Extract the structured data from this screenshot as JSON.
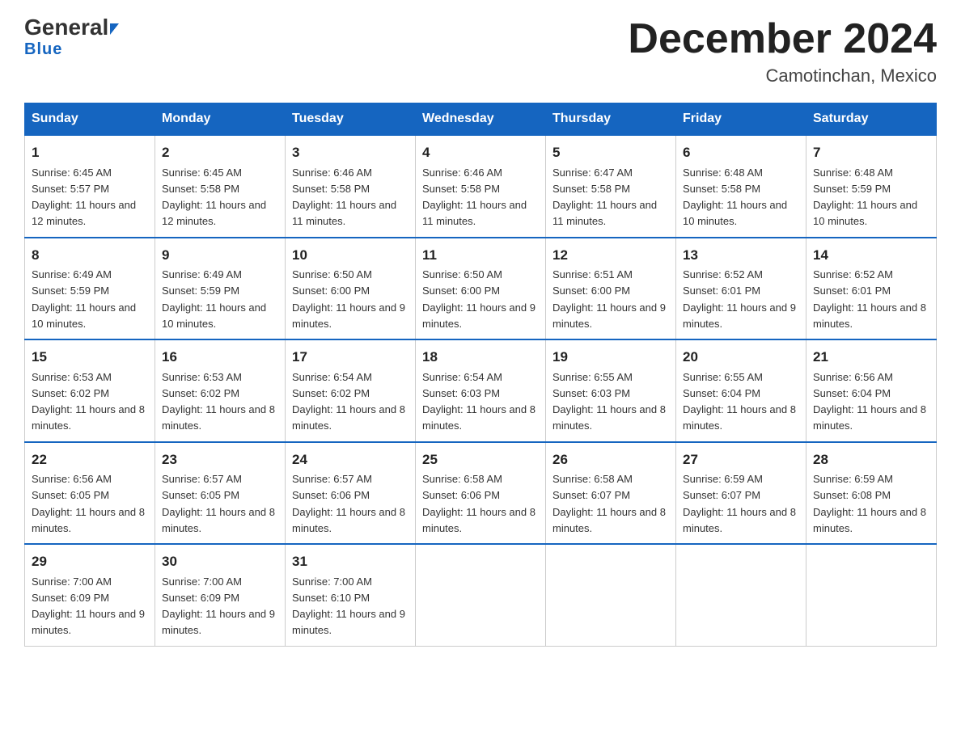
{
  "header": {
    "logo_general": "General",
    "logo_blue": "Blue",
    "title": "December 2024",
    "subtitle": "Camotinchan, Mexico"
  },
  "days_of_week": [
    "Sunday",
    "Monday",
    "Tuesday",
    "Wednesday",
    "Thursday",
    "Friday",
    "Saturday"
  ],
  "weeks": [
    [
      {
        "day": "1",
        "sunrise": "6:45 AM",
        "sunset": "5:57 PM",
        "daylight": "11 hours and 12 minutes."
      },
      {
        "day": "2",
        "sunrise": "6:45 AM",
        "sunset": "5:58 PM",
        "daylight": "11 hours and 12 minutes."
      },
      {
        "day": "3",
        "sunrise": "6:46 AM",
        "sunset": "5:58 PM",
        "daylight": "11 hours and 11 minutes."
      },
      {
        "day": "4",
        "sunrise": "6:46 AM",
        "sunset": "5:58 PM",
        "daylight": "11 hours and 11 minutes."
      },
      {
        "day": "5",
        "sunrise": "6:47 AM",
        "sunset": "5:58 PM",
        "daylight": "11 hours and 11 minutes."
      },
      {
        "day": "6",
        "sunrise": "6:48 AM",
        "sunset": "5:58 PM",
        "daylight": "11 hours and 10 minutes."
      },
      {
        "day": "7",
        "sunrise": "6:48 AM",
        "sunset": "5:59 PM",
        "daylight": "11 hours and 10 minutes."
      }
    ],
    [
      {
        "day": "8",
        "sunrise": "6:49 AM",
        "sunset": "5:59 PM",
        "daylight": "11 hours and 10 minutes."
      },
      {
        "day": "9",
        "sunrise": "6:49 AM",
        "sunset": "5:59 PM",
        "daylight": "11 hours and 10 minutes."
      },
      {
        "day": "10",
        "sunrise": "6:50 AM",
        "sunset": "6:00 PM",
        "daylight": "11 hours and 9 minutes."
      },
      {
        "day": "11",
        "sunrise": "6:50 AM",
        "sunset": "6:00 PM",
        "daylight": "11 hours and 9 minutes."
      },
      {
        "day": "12",
        "sunrise": "6:51 AM",
        "sunset": "6:00 PM",
        "daylight": "11 hours and 9 minutes."
      },
      {
        "day": "13",
        "sunrise": "6:52 AM",
        "sunset": "6:01 PM",
        "daylight": "11 hours and 9 minutes."
      },
      {
        "day": "14",
        "sunrise": "6:52 AM",
        "sunset": "6:01 PM",
        "daylight": "11 hours and 8 minutes."
      }
    ],
    [
      {
        "day": "15",
        "sunrise": "6:53 AM",
        "sunset": "6:02 PM",
        "daylight": "11 hours and 8 minutes."
      },
      {
        "day": "16",
        "sunrise": "6:53 AM",
        "sunset": "6:02 PM",
        "daylight": "11 hours and 8 minutes."
      },
      {
        "day": "17",
        "sunrise": "6:54 AM",
        "sunset": "6:02 PM",
        "daylight": "11 hours and 8 minutes."
      },
      {
        "day": "18",
        "sunrise": "6:54 AM",
        "sunset": "6:03 PM",
        "daylight": "11 hours and 8 minutes."
      },
      {
        "day": "19",
        "sunrise": "6:55 AM",
        "sunset": "6:03 PM",
        "daylight": "11 hours and 8 minutes."
      },
      {
        "day": "20",
        "sunrise": "6:55 AM",
        "sunset": "6:04 PM",
        "daylight": "11 hours and 8 minutes."
      },
      {
        "day": "21",
        "sunrise": "6:56 AM",
        "sunset": "6:04 PM",
        "daylight": "11 hours and 8 minutes."
      }
    ],
    [
      {
        "day": "22",
        "sunrise": "6:56 AM",
        "sunset": "6:05 PM",
        "daylight": "11 hours and 8 minutes."
      },
      {
        "day": "23",
        "sunrise": "6:57 AM",
        "sunset": "6:05 PM",
        "daylight": "11 hours and 8 minutes."
      },
      {
        "day": "24",
        "sunrise": "6:57 AM",
        "sunset": "6:06 PM",
        "daylight": "11 hours and 8 minutes."
      },
      {
        "day": "25",
        "sunrise": "6:58 AM",
        "sunset": "6:06 PM",
        "daylight": "11 hours and 8 minutes."
      },
      {
        "day": "26",
        "sunrise": "6:58 AM",
        "sunset": "6:07 PM",
        "daylight": "11 hours and 8 minutes."
      },
      {
        "day": "27",
        "sunrise": "6:59 AM",
        "sunset": "6:07 PM",
        "daylight": "11 hours and 8 minutes."
      },
      {
        "day": "28",
        "sunrise": "6:59 AM",
        "sunset": "6:08 PM",
        "daylight": "11 hours and 8 minutes."
      }
    ],
    [
      {
        "day": "29",
        "sunrise": "7:00 AM",
        "sunset": "6:09 PM",
        "daylight": "11 hours and 9 minutes."
      },
      {
        "day": "30",
        "sunrise": "7:00 AM",
        "sunset": "6:09 PM",
        "daylight": "11 hours and 9 minutes."
      },
      {
        "day": "31",
        "sunrise": "7:00 AM",
        "sunset": "6:10 PM",
        "daylight": "11 hours and 9 minutes."
      },
      null,
      null,
      null,
      null
    ]
  ]
}
